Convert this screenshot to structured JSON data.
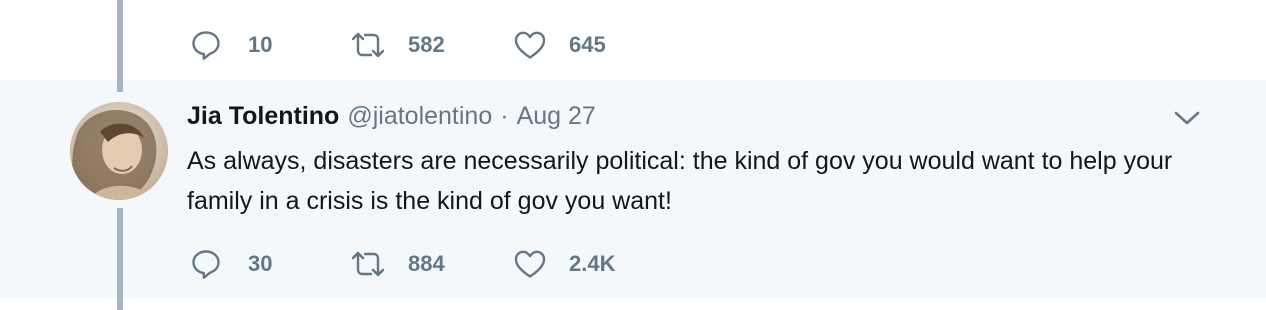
{
  "previous_tweet": {
    "reply_count": "10",
    "retweet_count": "582",
    "like_count": "645"
  },
  "tweet": {
    "fullname": "Jia Tolentino",
    "username": "@jiatolentino",
    "separator": "·",
    "timestamp": "Aug 27",
    "text": "As always, disasters are necessarily political: the kind of gov you would want to help your family in a crisis is the kind of gov you want!",
    "reply_count": "30",
    "retweet_count": "884",
    "like_count": "2.4K"
  },
  "icons": {
    "reply": "reply-bubble-icon",
    "retweet": "retweet-arrows-icon",
    "like": "heart-icon",
    "menu": "chevron-down-icon"
  },
  "colors": {
    "tweet_background": "#f5f8fa",
    "thread_line": "#a7b6c2",
    "secondary_text": "#657786",
    "primary_text": "#14171a"
  }
}
